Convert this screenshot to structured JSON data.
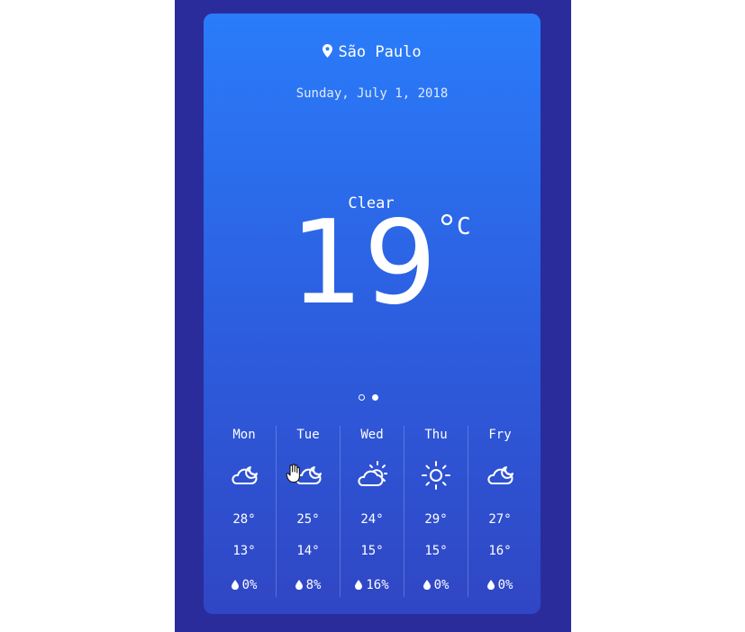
{
  "location": {
    "icon": "map-pin-icon",
    "city": "São Paulo"
  },
  "date": "Sunday, July 1, 2018",
  "current": {
    "condition": "Clear",
    "temperature": "19",
    "unit": "C"
  },
  "pager": {
    "pages": 2,
    "active": 2
  },
  "forecast": [
    {
      "day": "Mon",
      "icon": "partly-cloudy-night-icon",
      "high": "28°",
      "low": "13°",
      "rain": "0%"
    },
    {
      "day": "Tue",
      "icon": "partly-cloudy-night-icon",
      "high": "25°",
      "low": "14°",
      "rain": "8%"
    },
    {
      "day": "Wed",
      "icon": "partly-cloudy-day-icon",
      "high": "24°",
      "low": "15°",
      "rain": "16%"
    },
    {
      "day": "Thu",
      "icon": "sun-icon",
      "high": "29°",
      "low": "15°",
      "rain": "0%"
    },
    {
      "day": "Fry",
      "icon": "partly-cloudy-night-icon",
      "high": "27°",
      "low": "16°",
      "rain": "0%"
    }
  ],
  "colors": {
    "frame": "#2a2c9c",
    "card_top": "#2a7cfa",
    "card_bottom": "#3046c4",
    "text": "#ffffff"
  }
}
